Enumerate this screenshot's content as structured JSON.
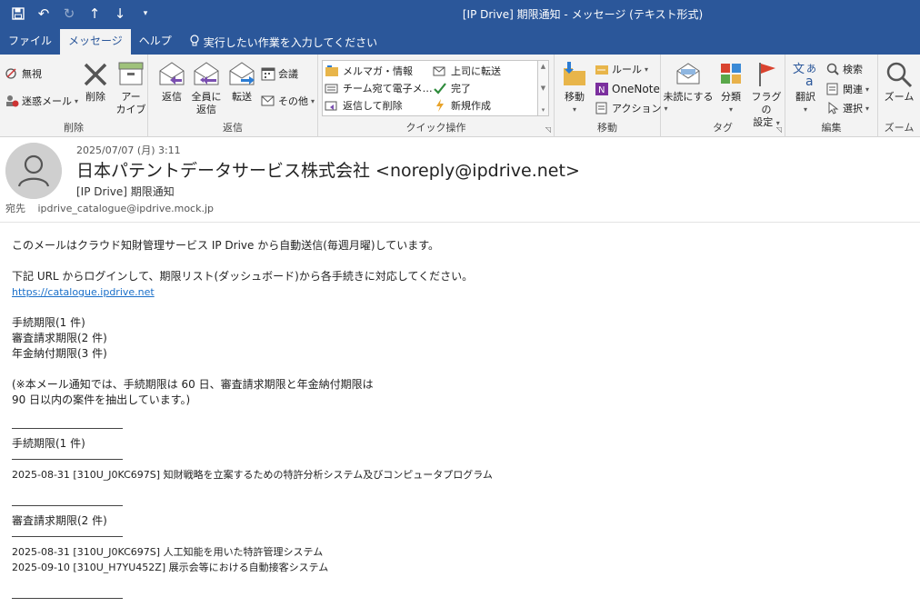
{
  "window": {
    "title": "[IP Drive] 期限通知  -  メッセージ (テキスト形式)"
  },
  "tabs": [
    {
      "label": "ファイル",
      "active": false
    },
    {
      "label": "メッセージ",
      "active": true
    },
    {
      "label": "ヘルプ",
      "active": false
    }
  ],
  "tell_me": "実行したい作業を入力してください",
  "ribbon": {
    "delete_group": {
      "label": "削除",
      "ignore": "無視",
      "junk": "迷惑メール",
      "delete": "削除",
      "archive_1": "アー",
      "archive_2": "カイブ"
    },
    "respond_group": {
      "label": "返信",
      "reply": "返信",
      "reply_all_1": "全員に",
      "reply_all_2": "返信",
      "forward": "転送",
      "meeting": "会議",
      "more": "その他"
    },
    "quick_steps": {
      "label": "クイック操作",
      "items": [
        "メルマガ・情報",
        "上司に転送",
        "チーム宛て電子メ…",
        "完了",
        "返信して削除",
        "新規作成"
      ]
    },
    "move_group": {
      "label": "移動",
      "move": "移動",
      "rules": "ルール",
      "onenote": "OneNote",
      "actions": "アクション"
    },
    "tags_group": {
      "label": "タグ",
      "unread": "未読にする",
      "categorize": "分類",
      "flag_1": "フラグの",
      "flag_2": "設定"
    },
    "edit_group": {
      "label": "編集",
      "translate": "翻訳",
      "find": "検索",
      "related": "関連",
      "select": "選択"
    },
    "zoom_group": {
      "label": "ズーム",
      "zoom": "ズーム"
    }
  },
  "message": {
    "date": "2025/07/07 (月) 3:11",
    "sender": "日本パテントデータサービス株式会社 <noreply@ipdrive.net>",
    "subject": "[IP Drive] 期限通知",
    "to_label": "宛先",
    "to": "ipdrive_catalogue@ipdrive.mock.jp"
  },
  "body": {
    "intro": "このメールはクラウド知財管理サービス IP Drive から自動送信(毎週月曜)しています。",
    "instruction": "下記 URL からログインして、期限リスト(ダッシュボード)から各手続きに対応してください。",
    "link": "https://catalogue.ipdrive.net",
    "summary": [
      "手続期限(1 件)",
      "審査請求期限(2 件)",
      "年金納付期限(3 件)"
    ],
    "note_1": "(※本メール通知では、手続期限は 60 日、審査請求期限と年金納付期限は",
    "note_2": "90 日以内の案件を抽出しています。)",
    "section_1_title": "手続期限(1 件)",
    "section_1_items": [
      "2025-08-31 [310U_J0KC697S] 知財戦略を立案するための特許分析システム及びコンピュータプログラム"
    ],
    "section_2_title": "審査請求期限(2 件)",
    "section_2_items": [
      "2025-08-31 [310U_J0KC697S] 人工知能を用いた特許管理システム",
      "2025-09-10 [310U_H7YU452Z] 展示会等における自動接客システム"
    ]
  }
}
